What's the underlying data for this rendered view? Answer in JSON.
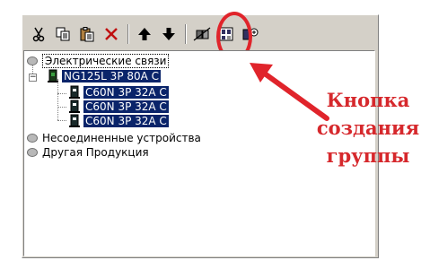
{
  "toolbar": {
    "buttons": [
      {
        "icon": "cut-icon"
      },
      {
        "icon": "copy-icon"
      },
      {
        "icon": "paste-icon"
      },
      {
        "icon": "delete-icon"
      },
      {
        "icon": "move-up-icon"
      },
      {
        "icon": "move-down-icon"
      },
      {
        "icon": "disconnect-icon"
      },
      {
        "icon": "create-group-icon"
      },
      {
        "icon": "properties-icon"
      }
    ]
  },
  "tree": {
    "root_electrical": "Электрические связи",
    "breaker": "NG125L 3P 80A  C",
    "children": [
      "C60N 3P 32A  C",
      "C60N 3P 32A  C",
      "C60N 3P 32A  C"
    ],
    "unconnected": "Несоединенные устройства",
    "other": "Другая Продукция"
  },
  "callout": {
    "line1": "Кнопка",
    "line2": "создания",
    "line3": "группы"
  },
  "colors": {
    "accent": "#e0242b",
    "selection": "#0a246a"
  }
}
